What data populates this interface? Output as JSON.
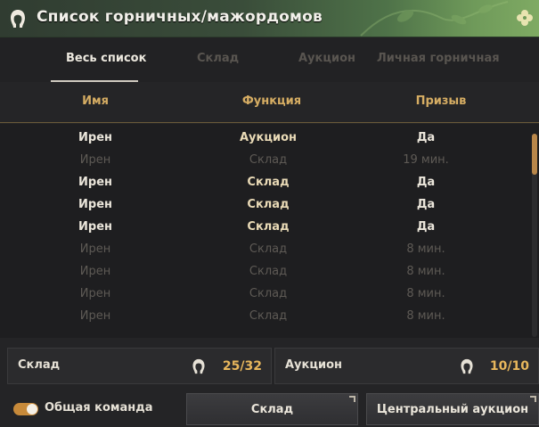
{
  "window": {
    "title": "Список горничных/мажордомов"
  },
  "icons": {
    "title": "maid-icon",
    "corner": "clover-icon"
  },
  "tabs": [
    {
      "label": "Весь список",
      "active": true
    },
    {
      "label": "Склад",
      "active": false
    },
    {
      "label": "Аукцион",
      "active": false
    },
    {
      "label": "Личная горничная",
      "active": false
    }
  ],
  "columns": [
    "Имя",
    "Функция",
    "Призыв"
  ],
  "rows": [
    {
      "name": "Ирен",
      "function": "Аукцион",
      "summon": "Да",
      "active": true
    },
    {
      "name": "Ирен",
      "function": "Склад",
      "summon": "19 мин.",
      "active": false
    },
    {
      "name": "Ирен",
      "function": "Склад",
      "summon": "Да",
      "active": true
    },
    {
      "name": "Ирен",
      "function": "Склад",
      "summon": "Да",
      "active": true
    },
    {
      "name": "Ирен",
      "function": "Склад",
      "summon": "Да",
      "active": true
    },
    {
      "name": "Ирен",
      "function": "Склад",
      "summon": "8 мин.",
      "active": false
    },
    {
      "name": "Ирен",
      "function": "Склад",
      "summon": "8 мин.",
      "active": false
    },
    {
      "name": "Ирен",
      "function": "Склад",
      "summon": "8 мин.",
      "active": false
    },
    {
      "name": "Ирен",
      "function": "Склад",
      "summon": "8 мин.",
      "active": false
    }
  ],
  "summary": {
    "storage": {
      "label": "Склад",
      "count": "25/32"
    },
    "auction": {
      "label": "Аукцион",
      "count": "10/10"
    }
  },
  "footer": {
    "toggle_label": "Общая команда",
    "toggle_on": true,
    "storage_button": "Склад",
    "auction_button": "Центральный аукцион"
  },
  "colors": {
    "accent": "#d6ad63",
    "count": "#e8b75c",
    "toggle": "#c78a3a",
    "title_green": "#4f7349"
  }
}
